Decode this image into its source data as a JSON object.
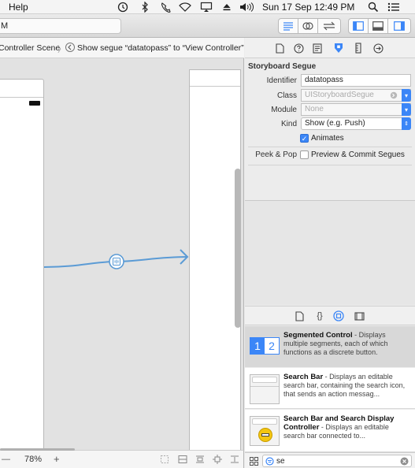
{
  "menubar": {
    "help": "Help",
    "clock": "Sun 17 Sep  12:49 PM"
  },
  "toolbar": {
    "activity_text": "M"
  },
  "jumpbar": {
    "crumb_scene": "Controller Scene",
    "crumb_segue": "Show segue “datatopass” to “View Controller”"
  },
  "canvas": {
    "zoom": "78%",
    "zoom_out": "—",
    "zoom_in": "+"
  },
  "inspector": {
    "section_title": "Storyboard Segue",
    "identifier_label": "Identifier",
    "identifier_value": "datatopass",
    "class_label": "Class",
    "class_placeholder": "UIStoryboardSegue",
    "module_label": "Module",
    "module_placeholder": "None",
    "kind_label": "Kind",
    "kind_value": "Show (e.g. Push)",
    "animates_label": "Animates",
    "animates_checked": true,
    "peek_label": "Peek & Pop",
    "peek_option": "Preview & Commit Segues",
    "peek_checked": false
  },
  "library": {
    "items": [
      {
        "title": "Segmented Control",
        "desc": " - Displays multiple segments, each of which functions as a discrete button.",
        "icon_nums": [
          "1",
          "2"
        ]
      },
      {
        "title": "Search Bar",
        "desc": " - Displays an editable search bar, containing the search icon, that sends an action messag..."
      },
      {
        "title": "Search Bar and Search Display Controller",
        "desc": " - Displays an editable search bar connected to..."
      }
    ],
    "filter_value": "se"
  },
  "colors": {
    "accent": "#3b86f7",
    "segue_line": "#5b9bd5"
  }
}
